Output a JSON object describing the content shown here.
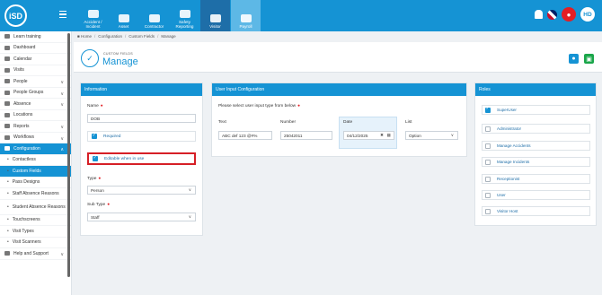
{
  "app": {
    "logo_text": "iSD"
  },
  "topnav": [
    {
      "label": "Accident / Incident",
      "icon": "accident-icon"
    },
    {
      "label": "Asset",
      "icon": "asset-icon"
    },
    {
      "label": "Contractor",
      "icon": "contractor-icon"
    },
    {
      "label": "Safety Reporting",
      "icon": "safety-icon"
    },
    {
      "label": "Visitor",
      "icon": "visitor-icon"
    },
    {
      "label": "Payroll",
      "icon": "payroll-icon"
    }
  ],
  "user": {
    "initials": "HD"
  },
  "sidebar": {
    "items": [
      {
        "label": "Learn training"
      },
      {
        "label": "Dashboard"
      },
      {
        "label": "Calendar"
      },
      {
        "label": "Visits"
      },
      {
        "label": "People"
      },
      {
        "label": "People Groups"
      },
      {
        "label": "Absence"
      },
      {
        "label": "Locations"
      },
      {
        "label": "Reports"
      },
      {
        "label": "Workflows"
      },
      {
        "label": "Configuration"
      }
    ],
    "sub": [
      {
        "label": "Contactless"
      },
      {
        "label": "Custom Fields"
      },
      {
        "label": "Pass Designs"
      },
      {
        "label": "Staff Absence Reasons"
      },
      {
        "label": "Student Absence Reasons"
      },
      {
        "label": "Touchscreens"
      },
      {
        "label": "Visit Types"
      },
      {
        "label": "Visit Scanners"
      }
    ],
    "bottom": {
      "label": "Help and Support"
    }
  },
  "breadcrumb": {
    "home": "Home",
    "configuration": "Configuration",
    "custom_fields": "Custom Fields",
    "manage": "Manage"
  },
  "header": {
    "small": "CUSTOM FIELDS",
    "title": "Manage"
  },
  "info": {
    "title": "Information",
    "name_label": "Name",
    "name_value": "DOB",
    "required_label": "Required",
    "editable_label": "Editable when in use",
    "type_label": "Type",
    "type_value": "Person",
    "subtype_label": "Sub Type",
    "subtype_value": "Staff"
  },
  "input_config": {
    "title": "User Input Configuration",
    "prompt": "Please select user input type from below",
    "text_label": "Text",
    "text_value": "ABC def 123 @#%",
    "number_label": "Number",
    "number_value": "25042011",
    "date_label": "Date",
    "date_value": "04/12/2025",
    "list_label": "List",
    "list_value": "Option"
  },
  "roles": {
    "title": "Roles",
    "items": [
      {
        "label": "SuperUser",
        "checked": true
      },
      {
        "label": "Administrator",
        "checked": false
      },
      {
        "label": "Manage Accidents",
        "checked": false
      },
      {
        "label": "Manage Incidents",
        "checked": false
      },
      {
        "label": "Receptionist",
        "checked": false
      },
      {
        "label": "User",
        "checked": false
      },
      {
        "label": "Visitor Host",
        "checked": false
      }
    ]
  },
  "colors": {
    "primary": "#1593d4",
    "highlight": "#d61f26",
    "success": "#1aa64a"
  }
}
